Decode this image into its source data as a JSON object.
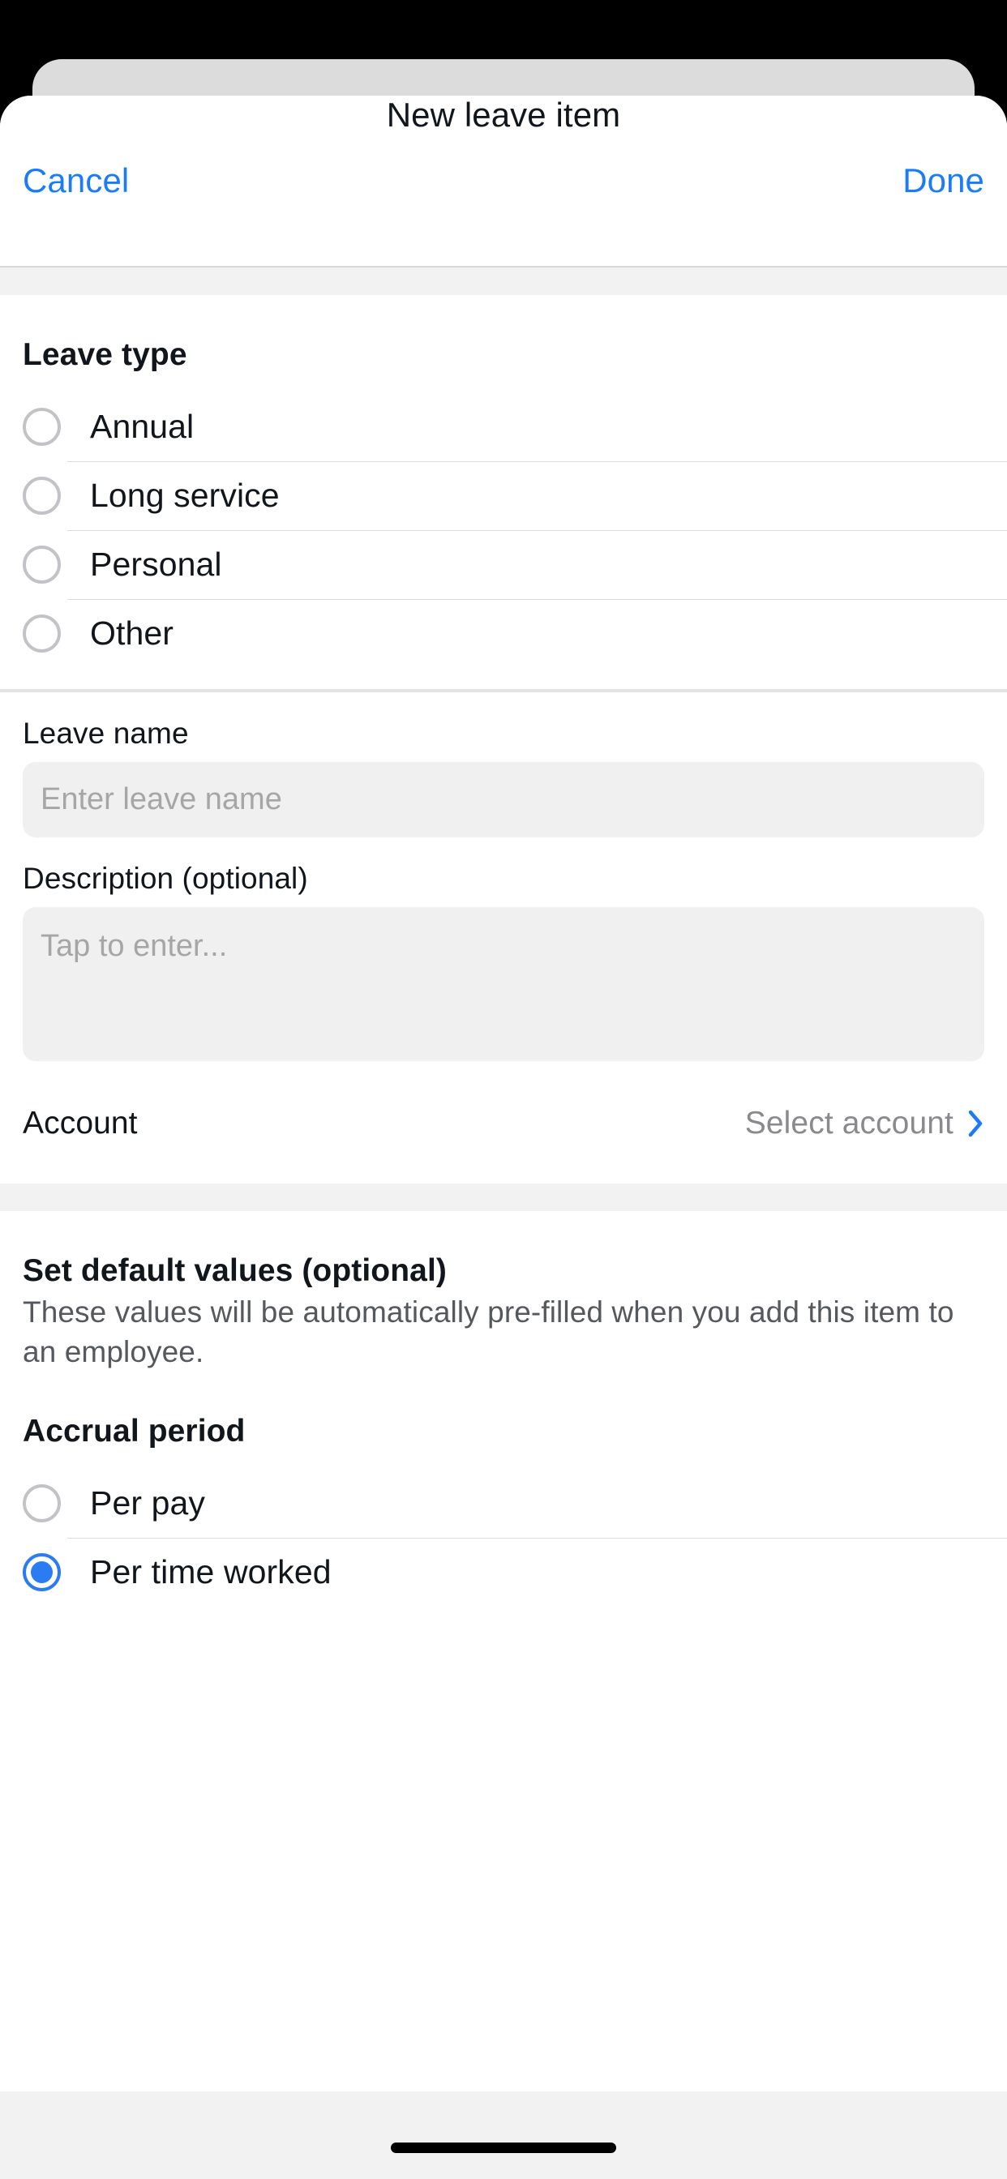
{
  "navbar": {
    "cancel_label": "Cancel",
    "title": "New leave item",
    "done_label": "Done"
  },
  "leave_type": {
    "heading": "Leave type",
    "options": [
      {
        "label": "Annual",
        "selected": false
      },
      {
        "label": "Long service",
        "selected": false
      },
      {
        "label": "Personal",
        "selected": false
      },
      {
        "label": "Other",
        "selected": false
      }
    ]
  },
  "details": {
    "leave_name_label": "Leave name",
    "leave_name_value": "",
    "leave_name_placeholder": "Enter leave name",
    "description_label": "Description (optional)",
    "description_value": "",
    "description_placeholder": "Tap to enter...",
    "account_label": "Account",
    "account_value": "Select account",
    "chevron_icon": "chevron-right-icon"
  },
  "defaults": {
    "heading": "Set default values (optional)",
    "subtext": "These values will be automatically pre-filled when you add this item to an employee."
  },
  "accrual": {
    "heading": "Accrual period",
    "options": [
      {
        "label": "Per pay",
        "selected": false
      },
      {
        "label": "Per time worked",
        "selected": true
      }
    ]
  },
  "colors": {
    "accent": "#1c7cf5",
    "radio_selected": "#2b7bf3",
    "radio_unselected": "#c3c3c7",
    "field_bg": "#f0f0f0",
    "band_bg": "#f2f2f2",
    "text_primary": "#10161c",
    "text_secondary": "#55595e",
    "placeholder": "#a6a6a6"
  }
}
